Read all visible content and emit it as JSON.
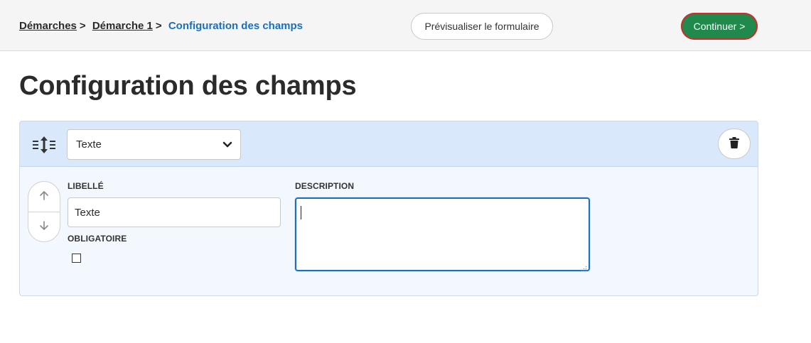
{
  "breadcrumb": {
    "items": [
      {
        "label": "Démarches"
      },
      {
        "label": "Démarche 1"
      }
    ],
    "separator": ">",
    "current": "Configuration des champs"
  },
  "header": {
    "preview_label": "Prévisualiser le formulaire",
    "continue_label": "Continuer >"
  },
  "page": {
    "title": "Configuration des champs"
  },
  "field_card": {
    "type_select": {
      "selected": "Texte"
    },
    "libelle": {
      "label": "LIBELLÉ",
      "value": "Texte"
    },
    "obligatoire": {
      "label": "OBLIGATOIRE",
      "checked": false
    },
    "description": {
      "label": "DESCRIPTION",
      "value": ""
    }
  },
  "icons": {
    "drag": "drag-handle-icon",
    "chevron": "chevron-down-icon",
    "delete": "trash-icon",
    "up": "arrow-up-icon",
    "down": "arrow-down-icon"
  },
  "colors": {
    "accent_blue": "#1a6fbf",
    "continue_green": "#1f8a4c",
    "header_bg": "#d9e9fb",
    "card_bg": "#f3f8fe"
  }
}
